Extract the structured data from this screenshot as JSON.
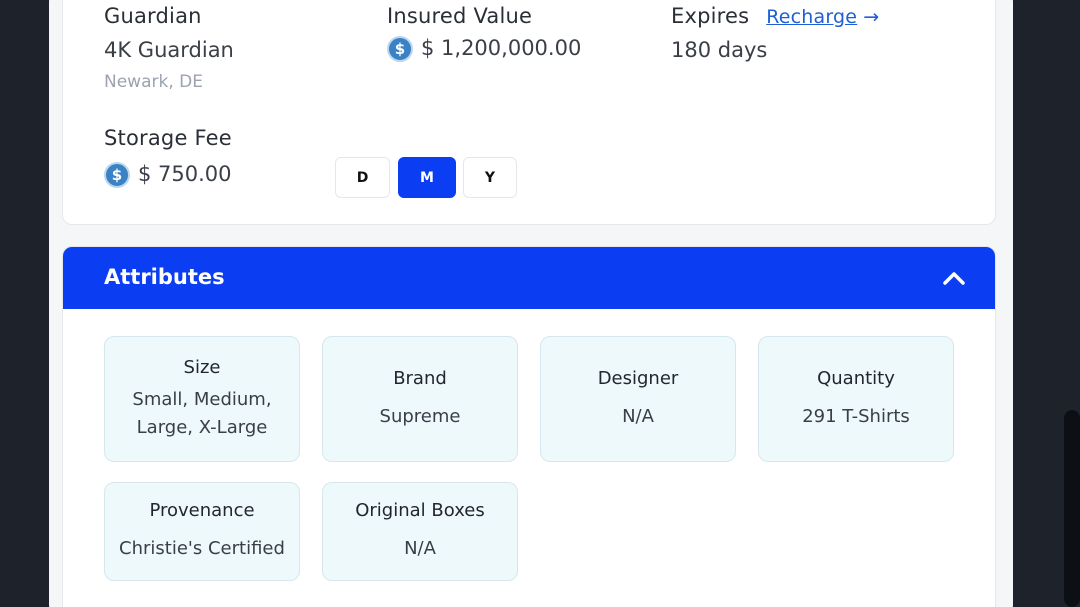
{
  "guardian": {
    "label": "Guardian",
    "name": "4K Guardian",
    "location": "Newark, DE"
  },
  "insured": {
    "label": "Insured Value",
    "value": "$ 1,200,000.00"
  },
  "expires": {
    "label": "Expires",
    "link": "Recharge",
    "arrow": "→",
    "value": "180 days"
  },
  "storage": {
    "label": "Storage Fee",
    "value": "$ 750.00",
    "periods": [
      "D",
      "M",
      "Y"
    ],
    "selected_period": "M"
  },
  "coin_icon": "usd-coin-icon",
  "colors": {
    "accent": "#0b3ef2",
    "tile_bg": "#eef9fc",
    "link": "#1d5fd6",
    "coin": "#3b82c4"
  },
  "attributes": {
    "title": "Attributes",
    "collapse_icon": "chevron-up-icon",
    "items": [
      {
        "label": "Size",
        "value": "Small, Medium, Large, X-Large"
      },
      {
        "label": "Brand",
        "value": "Supreme"
      },
      {
        "label": "Designer",
        "value": "N/A"
      },
      {
        "label": "Quantity",
        "value": "291 T-Shirts"
      },
      {
        "label": "Provenance",
        "value": "Christie's Certified"
      },
      {
        "label": "Original Boxes",
        "value": "N/A"
      }
    ]
  }
}
